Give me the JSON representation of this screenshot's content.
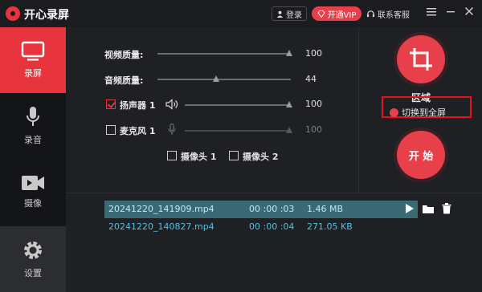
{
  "window": {
    "title": "开心录屏",
    "login_label": "登录",
    "vip_label": "开通VIP",
    "support_label": "联系客服"
  },
  "sidebar": {
    "items": [
      {
        "label": "录屏",
        "icon": "monitor-icon",
        "active": true
      },
      {
        "label": "录音",
        "icon": "microphone-icon",
        "active": false
      },
      {
        "label": "摄像",
        "icon": "camera-icon",
        "active": false
      },
      {
        "label": "设置",
        "icon": "gear-icon",
        "active": false
      }
    ]
  },
  "controls": {
    "video_quality": {
      "label": "视频质量:",
      "value": "100"
    },
    "audio_quality": {
      "label": "音频质量:",
      "value": "44"
    },
    "speaker": {
      "label": "扬声器 1",
      "checked": true,
      "value": "100"
    },
    "microphone": {
      "label": "麦克风 1",
      "checked": false,
      "value": "100"
    },
    "camera1": {
      "label": "摄像头 1",
      "checked": false
    },
    "camera2": {
      "label": "摄像头 2",
      "checked": false
    }
  },
  "capture": {
    "area_label": "区域",
    "switch_label": "切换到全屏",
    "start_label": "开 始"
  },
  "files": [
    {
      "name": "20241220_141909.mp4",
      "duration": "00 :00 :03",
      "size": "1.46 MB",
      "selected": true
    },
    {
      "name": "20241220_140827.mp4",
      "duration": "00 :00 :04",
      "size": "271.05 KB",
      "selected": false
    }
  ],
  "colors": {
    "accent": "#e8343c",
    "file_text": "#4fc3e6",
    "selected_row": "#3b6a74"
  }
}
